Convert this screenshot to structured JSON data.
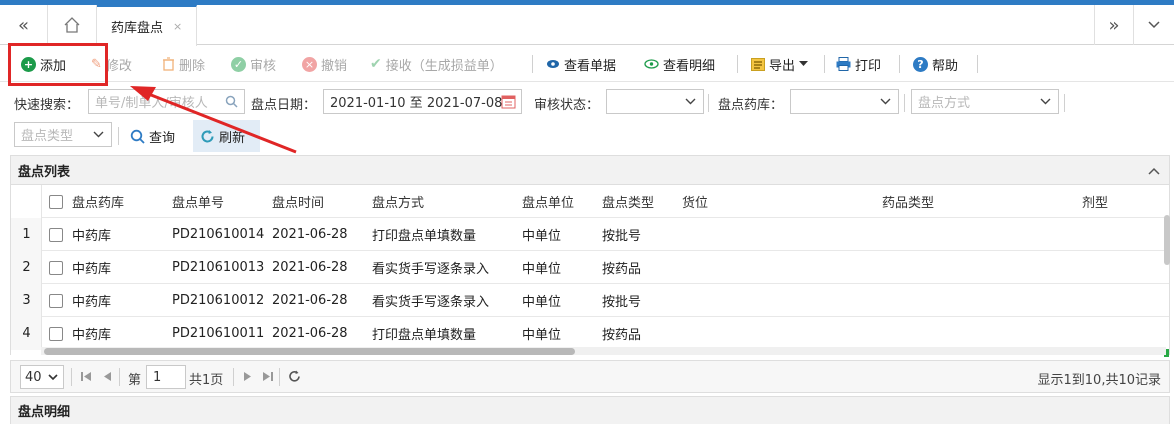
{
  "tabs": {
    "nav_back": "«",
    "nav_forward": "»",
    "active_tab_label": "药库盘点",
    "close_glyph": "×"
  },
  "toolbar": {
    "add": "添加",
    "edit": "修改",
    "delete": "删除",
    "audit": "审核",
    "revoke": "撤销",
    "receive": "接收（生成损益单）",
    "view_document": "查看单据",
    "view_detail": "查看明细",
    "export": "导出",
    "print": "打印",
    "help": "帮助"
  },
  "filters": {
    "quick_search_label": "快速搜索：",
    "quick_search_placeholder": "单号/制单人/审核人",
    "date_label": "盘点日期：",
    "date_value": "2021-01-10 至 2021-07-08",
    "audit_status_label": "审核状态：",
    "audit_status_value": "",
    "warehouse_label": "盘点药库：",
    "warehouse_value": "",
    "method_placeholder": "盘点方式",
    "type_placeholder": "盘点类型",
    "query_button": "查询",
    "refresh_button": "刷新"
  },
  "list_panel": {
    "title": "盘点列表",
    "collapse_glyph": "⌃",
    "columns": [
      "盘点药库",
      "盘点单号",
      "盘点时间",
      "盘点方式",
      "盘点单位",
      "盘点类型",
      "货位",
      "药品类型",
      "剂型"
    ],
    "rows": [
      {
        "num": "1",
        "warehouse": "中药库",
        "order_no": "PD210610014",
        "time": "2021-06-28",
        "method": "打印盘点单填数量",
        "unit": "中单位",
        "type": "按批号",
        "location": "",
        "drug_type": "",
        "form": ""
      },
      {
        "num": "2",
        "warehouse": "中药库",
        "order_no": "PD210610013",
        "time": "2021-06-28",
        "method": "看实货手写逐条录入",
        "unit": "中单位",
        "type": "按药品",
        "location": "",
        "drug_type": "",
        "form": ""
      },
      {
        "num": "3",
        "warehouse": "中药库",
        "order_no": "PD210610012",
        "time": "2021-06-28",
        "method": "看实货手写逐条录入",
        "unit": "中单位",
        "type": "按批号",
        "location": "",
        "drug_type": "",
        "form": ""
      },
      {
        "num": "4",
        "warehouse": "中药库",
        "order_no": "PD210610011",
        "time": "2021-06-28",
        "method": "打印盘点单填数量",
        "unit": "中单位",
        "type": "按药品",
        "location": "",
        "drug_type": "",
        "form": ""
      }
    ]
  },
  "pager": {
    "page_size": "40",
    "page_prefix": "第",
    "page_value": "1",
    "total_pages": "共1页",
    "summary": "显示1到10,共10记录"
  },
  "detail_panel": {
    "title": "盘点明细"
  },
  "colors": {
    "accent": "#2e7bc4",
    "annotation": "#e02626",
    "add_icon": "#1c9b4a"
  }
}
